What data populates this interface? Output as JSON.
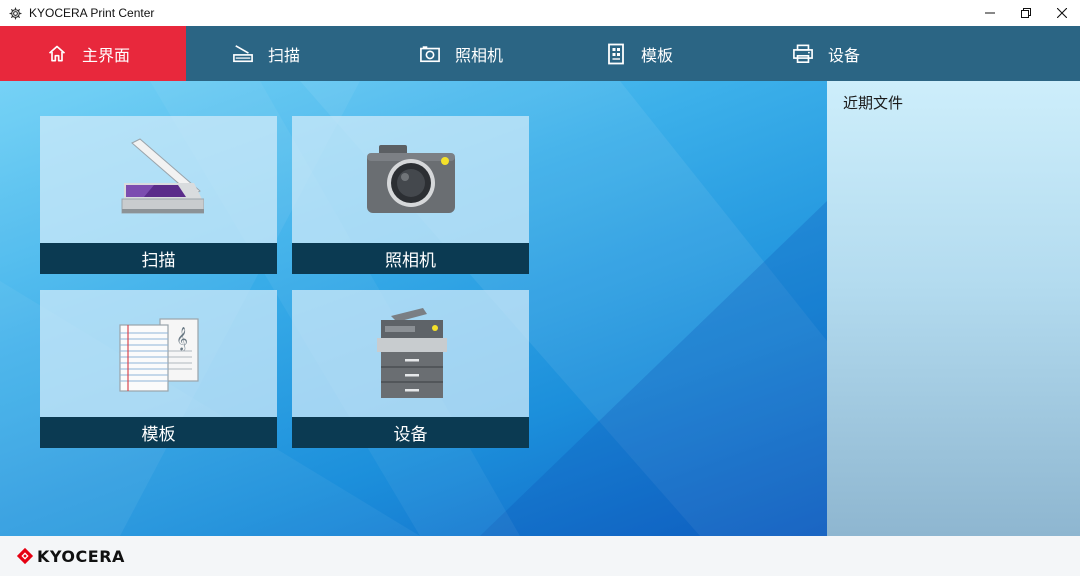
{
  "window": {
    "title": "KYOCERA Print Center"
  },
  "nav": {
    "items": [
      {
        "label": "主界面",
        "icon": "home-icon"
      },
      {
        "label": "扫描",
        "icon": "scanner-icon"
      },
      {
        "label": "照相机",
        "icon": "camera-icon"
      },
      {
        "label": "模板",
        "icon": "template-icon"
      },
      {
        "label": "设备",
        "icon": "printer-icon"
      }
    ],
    "active": "主界面"
  },
  "tiles": [
    {
      "label": "扫描",
      "icon": "scanner-icon"
    },
    {
      "label": "照相机",
      "icon": "camera-icon"
    },
    {
      "label": "模板",
      "icon": "template-icon"
    },
    {
      "label": "设备",
      "icon": "device-icon"
    }
  ],
  "side": {
    "title": "近期文件"
  },
  "footer": {
    "logo": "KYOCERA"
  },
  "colors": {
    "nav_bg": "#2b6584",
    "nav_active": "#e8283c",
    "tile_label_bg": "#0b3a52",
    "logo_red": "#e60012"
  }
}
